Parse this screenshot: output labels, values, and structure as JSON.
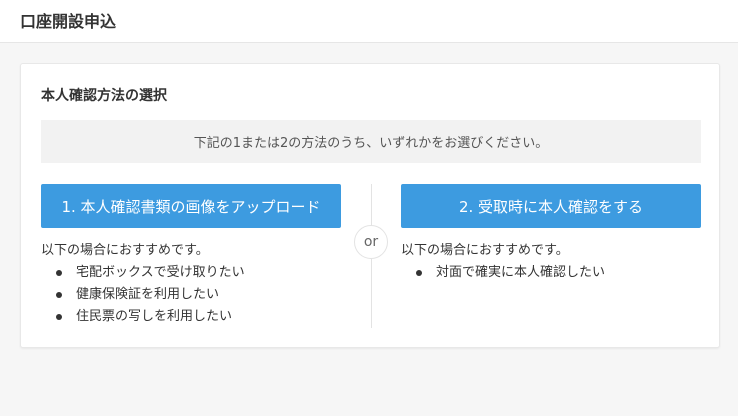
{
  "header": {
    "title": "口座開設申込"
  },
  "card": {
    "section_title": "本人確認方法の選択",
    "info_text": "下記の1または2の方法のうち、いずれかをお選びください。",
    "separator_label": "or",
    "options": [
      {
        "button_label": "1. 本人確認書類の画像をアップロード",
        "intro": "以下の場合におすすめです。",
        "items": [
          "宅配ボックスで受け取りたい",
          "健康保険証を利用したい",
          "住民票の写しを利用したい"
        ]
      },
      {
        "button_label": "2. 受取時に本人確認をする",
        "intro": "以下の場合におすすめです。",
        "items": [
          "対面で確実に本人確認したい"
        ]
      }
    ]
  },
  "colors": {
    "button_background": "#3d9be0",
    "button_text": "#ffffff",
    "info_background": "#f2f2f2",
    "page_background": "#f6f6f6"
  }
}
